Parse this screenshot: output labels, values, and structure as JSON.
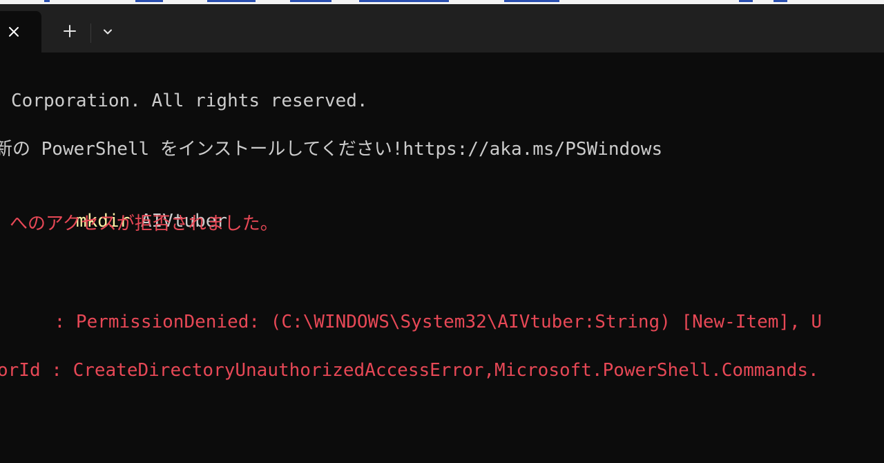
{
  "tabbar": {
    "close_icon": "close-icon",
    "new_tab_icon": "plus-icon",
    "dropdown_icon": "chevron-down-icon"
  },
  "terminal": {
    "copyright_line": "Corporation. All rights reserved.",
    "install_line": "新の PowerShell をインストールしてください!https://aka.ms/PSWindows",
    "command": "mkdir",
    "command_arg": " AIVtuber",
    "access_denied": "へのアクセスが拒否されました。",
    "category_info": "    : PermissionDenied: (C:\\WINDOWS\\System32\\AIVtuber:String) [New-Item], U",
    "error_id": "orId : CreateDirectoryUnauthorizedAccessError,Microsoft.PowerShell.Commands."
  },
  "colors": {
    "background": "#0c0c0c",
    "titlebar": "#202020",
    "text": "#cccccc",
    "error": "#e74856",
    "command": "#f9f1a5"
  }
}
